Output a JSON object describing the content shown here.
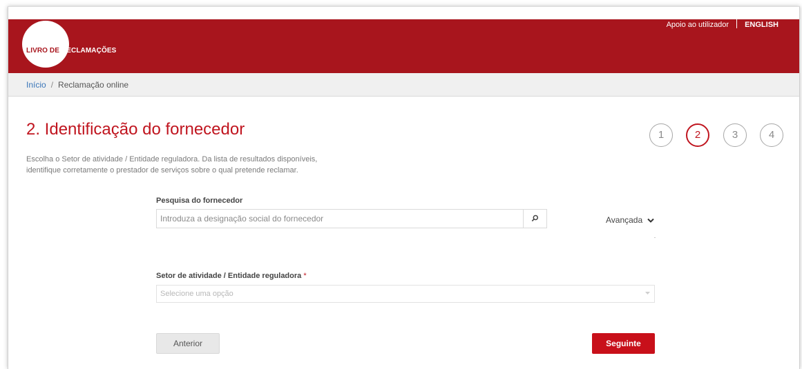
{
  "header": {
    "logo_part1": "LIVRO DE",
    "logo_part2": "RECLAMAÇÕES",
    "support_link": "Apoio ao utilizador",
    "language_link": "ENGLISH",
    "brand_color": "#a8151d"
  },
  "breadcrumb": {
    "home": "Início",
    "separator": "/",
    "current": "Reclamação online"
  },
  "main": {
    "title": "2. Identificação do fornecedor",
    "intro_line1": "Escolha o Setor de atividade / Entidade reguladora. Da lista de resultados disponíveis,",
    "intro_line2": "identifique corretamente o prestador de serviços sobre o qual pretende reclamar."
  },
  "steps": [
    "1",
    "2",
    "3",
    "4"
  ],
  "current_step": 2,
  "search": {
    "label": "Pesquisa do fornecedor",
    "placeholder": "Introduza a designação social do fornecedor",
    "value": "",
    "icon": "search-icon",
    "advanced_label": "Avançada"
  },
  "sector": {
    "label": "Setor de atividade / Entidade reguladora",
    "required_mark": "*",
    "placeholder": "Selecione uma opção"
  },
  "actions": {
    "previous_label": "Anterior",
    "next_label": "Seguinte",
    "next_color": "#c8101a"
  }
}
